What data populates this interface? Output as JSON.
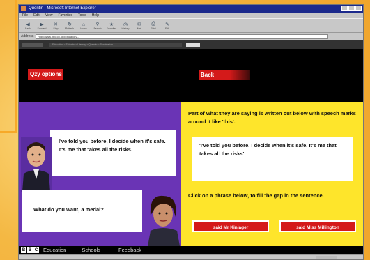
{
  "browser": {
    "title": "Quentin - Microsoft Internet Explorer",
    "menu": [
      "File",
      "Edit",
      "View",
      "Favorites",
      "Tools",
      "Help"
    ],
    "toolbar": [
      "Back",
      "Forward",
      "Stop",
      "Refresh",
      "Home",
      "Search",
      "Favorites",
      "History",
      "Mail",
      "Print",
      "Edit"
    ],
    "address_label": "Address",
    "address_value": "http://www.bbc.co.uk/education/..."
  },
  "site": {
    "crumb": "Education > Schools > Literacy > Quentin > Punctuation"
  },
  "buttons": {
    "options": "Qzy options",
    "back": "Back"
  },
  "left": {
    "bubble1": "I've told you before, I decide when it's safe. It's me that takes all the risks.",
    "bubble2": "What do you want, a medal?"
  },
  "right": {
    "instruction1": "Part of what they are saying is written out below with speech marks around it like 'this'.",
    "quote_part1": "'I've told you before, I decide when it's safe. It's me that takes all the risks'",
    "instruction2": "Click on a phrase below, to fill the gap in the sentence.",
    "answer1": "said Mr Kinlager",
    "answer2": "said Miss Millington"
  },
  "footer": {
    "logo": [
      "B",
      "B",
      "C"
    ],
    "education": "Education",
    "schools": "Schools",
    "feedback": "Feedback"
  },
  "colors": {
    "purple": "#6a34b5",
    "yellow": "#fee52b",
    "red": "#d41a1a"
  }
}
